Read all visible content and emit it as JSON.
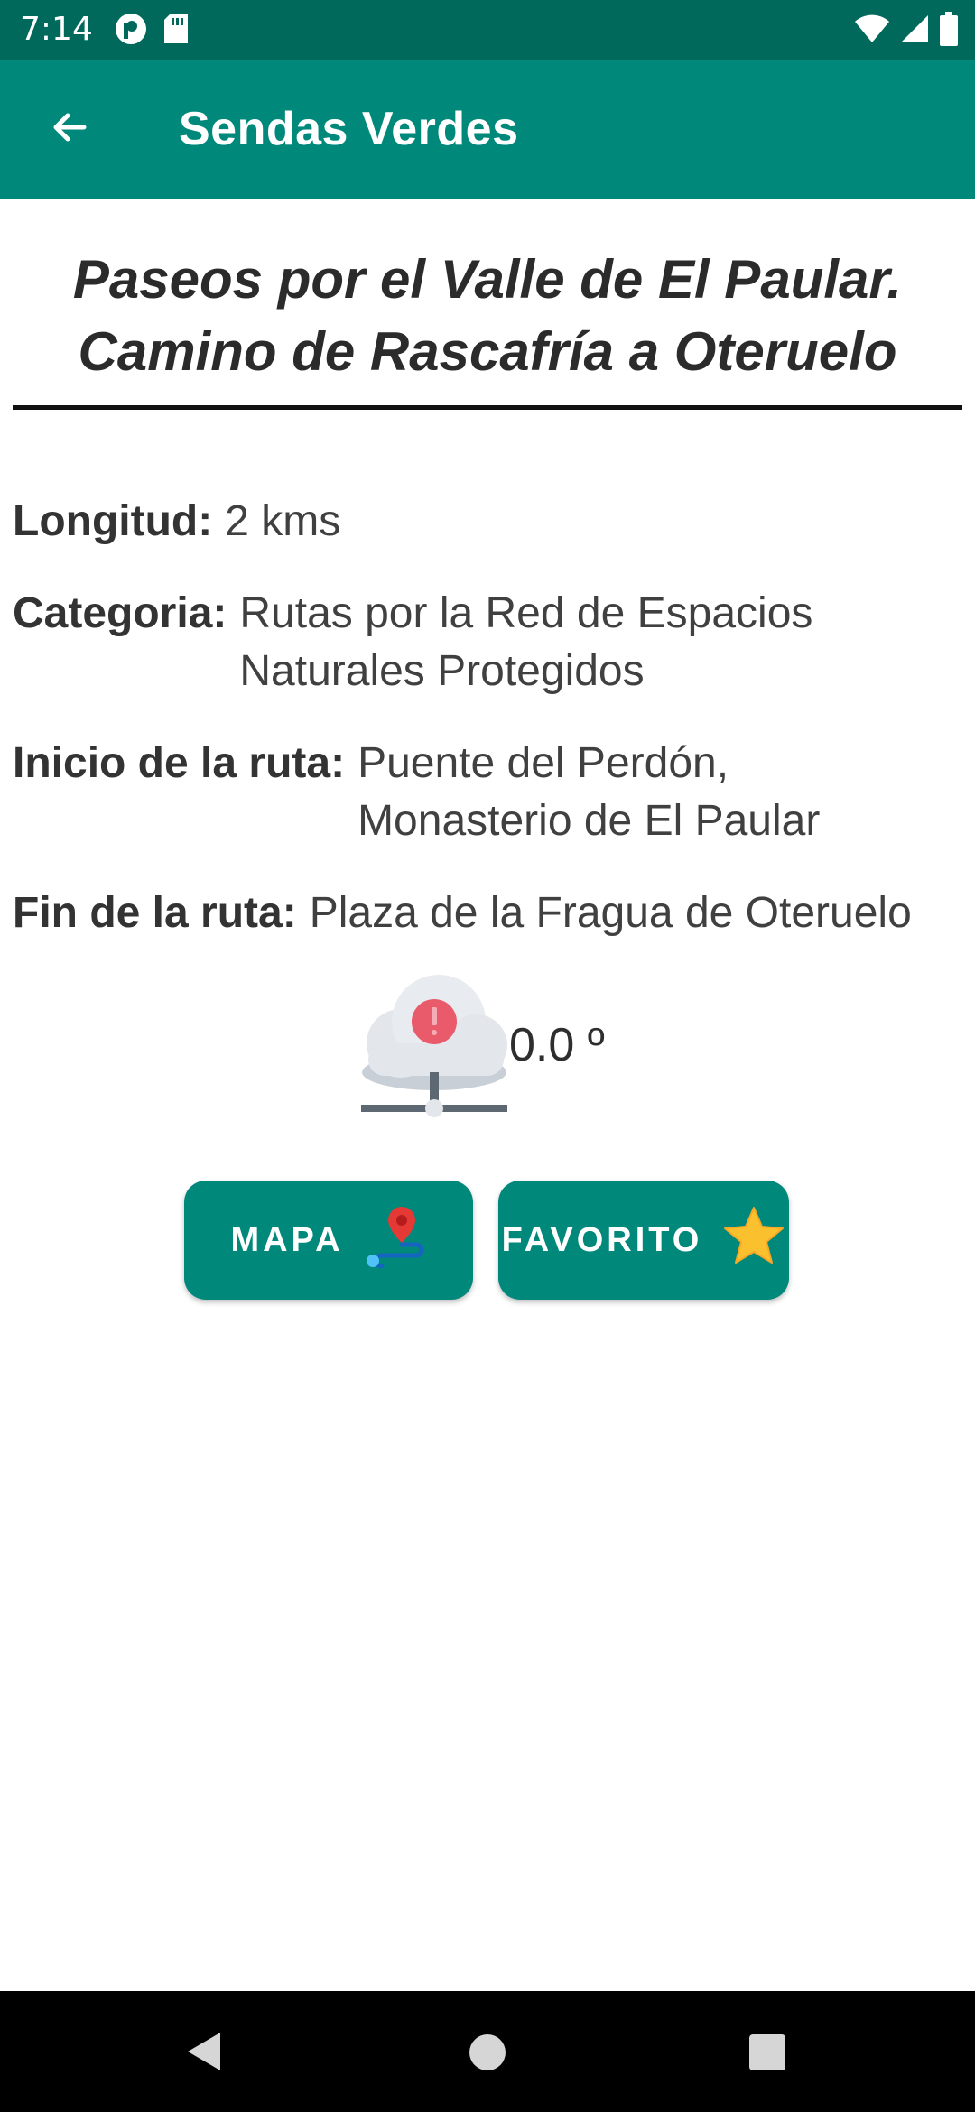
{
  "status_bar": {
    "time": "7:14",
    "icons": [
      "app-notification-icon",
      "sd-card-icon",
      "wifi-icon",
      "cell-signal-icon",
      "battery-icon"
    ]
  },
  "app_bar": {
    "title": "Sendas Verdes",
    "back_icon": "arrow-left-icon"
  },
  "route": {
    "title_line1": "Paseos por el Valle de El Paular.",
    "title_line2": "Camino de Rascafría a Oteruelo",
    "details": {
      "longitud_label": "Longitud:",
      "longitud_value": "2 kms",
      "categoria_label": "Categoria:",
      "categoria_value": "Rutas por la Red de Espacios Naturales Protegidos",
      "inicio_label": "Inicio de la ruta:",
      "inicio_value": "Puente del Perdón, Monasterio de El Paular",
      "fin_label": "Fin de la ruta:",
      "fin_value": "Plaza de la Fragua de Oteruelo"
    }
  },
  "weather": {
    "icon": "cloud-error-icon",
    "temperature": "0.0 º"
  },
  "actions": {
    "mapa_label": "MAPA",
    "mapa_icon": "map-route-pin-icon",
    "favorito_label": "FAVORITO",
    "favorito_icon": "star-icon"
  },
  "colors": {
    "status_bar": "#00695c",
    "primary": "#00897b",
    "star": "#fbc02d",
    "pin": "#e53935"
  }
}
